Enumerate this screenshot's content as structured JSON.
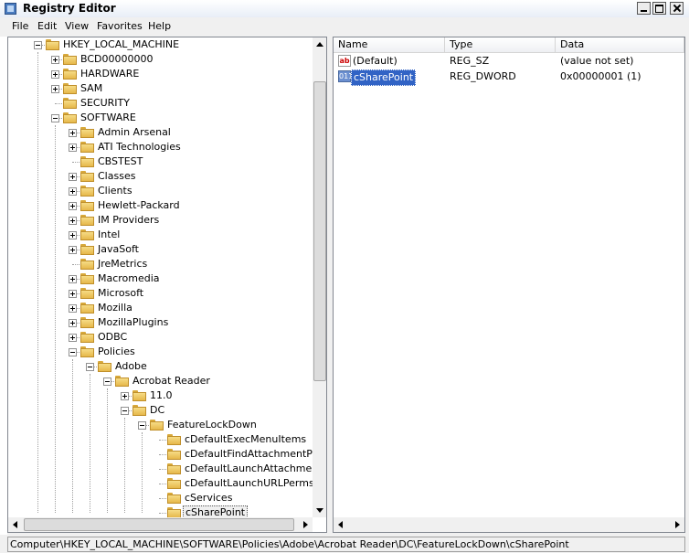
{
  "window": {
    "title": "Registry Editor"
  },
  "menu": [
    "File",
    "Edit",
    "View",
    "Favorites",
    "Help"
  ],
  "tree": [
    {
      "label": "HKEY_LOCAL_MACHINE",
      "depth": 0,
      "exp": "minus"
    },
    {
      "label": "BCD00000000",
      "depth": 1,
      "exp": "plus"
    },
    {
      "label": "HARDWARE",
      "depth": 1,
      "exp": "plus"
    },
    {
      "label": "SAM",
      "depth": 1,
      "exp": "plus"
    },
    {
      "label": "SECURITY",
      "depth": 1,
      "exp": ""
    },
    {
      "label": "SOFTWARE",
      "depth": 1,
      "exp": "minus"
    },
    {
      "label": "Admin Arsenal",
      "depth": 2,
      "exp": "plus"
    },
    {
      "label": "ATI Technologies",
      "depth": 2,
      "exp": "plus"
    },
    {
      "label": "CBSTEST",
      "depth": 2,
      "exp": ""
    },
    {
      "label": "Classes",
      "depth": 2,
      "exp": "plus"
    },
    {
      "label": "Clients",
      "depth": 2,
      "exp": "plus"
    },
    {
      "label": "Hewlett-Packard",
      "depth": 2,
      "exp": "plus"
    },
    {
      "label": "IM Providers",
      "depth": 2,
      "exp": "plus"
    },
    {
      "label": "Intel",
      "depth": 2,
      "exp": "plus"
    },
    {
      "label": "JavaSoft",
      "depth": 2,
      "exp": "plus"
    },
    {
      "label": "JreMetrics",
      "depth": 2,
      "exp": ""
    },
    {
      "label": "Macromedia",
      "depth": 2,
      "exp": "plus"
    },
    {
      "label": "Microsoft",
      "depth": 2,
      "exp": "plus"
    },
    {
      "label": "Mozilla",
      "depth": 2,
      "exp": "plus"
    },
    {
      "label": "MozillaPlugins",
      "depth": 2,
      "exp": "plus"
    },
    {
      "label": "ODBC",
      "depth": 2,
      "exp": "plus"
    },
    {
      "label": "Policies",
      "depth": 2,
      "exp": "minus"
    },
    {
      "label": "Adobe",
      "depth": 3,
      "exp": "minus"
    },
    {
      "label": "Acrobat Reader",
      "depth": 4,
      "exp": "minus"
    },
    {
      "label": "11.0",
      "depth": 5,
      "exp": "plus"
    },
    {
      "label": "DC",
      "depth": 5,
      "exp": "minus"
    },
    {
      "label": "FeatureLockDown",
      "depth": 6,
      "exp": "minus"
    },
    {
      "label": "cDefaultExecMenuItems",
      "depth": 7,
      "exp": ""
    },
    {
      "label": "cDefaultFindAttachmentPerms",
      "depth": 7,
      "exp": ""
    },
    {
      "label": "cDefaultLaunchAttachmentPerms",
      "depth": 7,
      "exp": ""
    },
    {
      "label": "cDefaultLaunchURLPerms",
      "depth": 7,
      "exp": ""
    },
    {
      "label": "cServices",
      "depth": 7,
      "exp": ""
    },
    {
      "label": "cSharePoint",
      "depth": 7,
      "exp": "",
      "selected": true
    }
  ],
  "list": {
    "columns": [
      "Name",
      "Type",
      "Data"
    ],
    "rows": [
      {
        "name": "(Default)",
        "type": "REG_SZ",
        "data": "(value not set)",
        "icon": "string-value-icon",
        "glyph": "ab"
      },
      {
        "name": "cSharePoint",
        "type": "REG_DWORD",
        "data": "0x00000001 (1)",
        "icon": "dword-value-icon",
        "glyph": "011",
        "selected": true
      }
    ]
  },
  "status": "Computer\\HKEY_LOCAL_MACHINE\\SOFTWARE\\Policies\\Adobe\\Acrobat Reader\\DC\\FeatureLockDown\\cSharePoint"
}
